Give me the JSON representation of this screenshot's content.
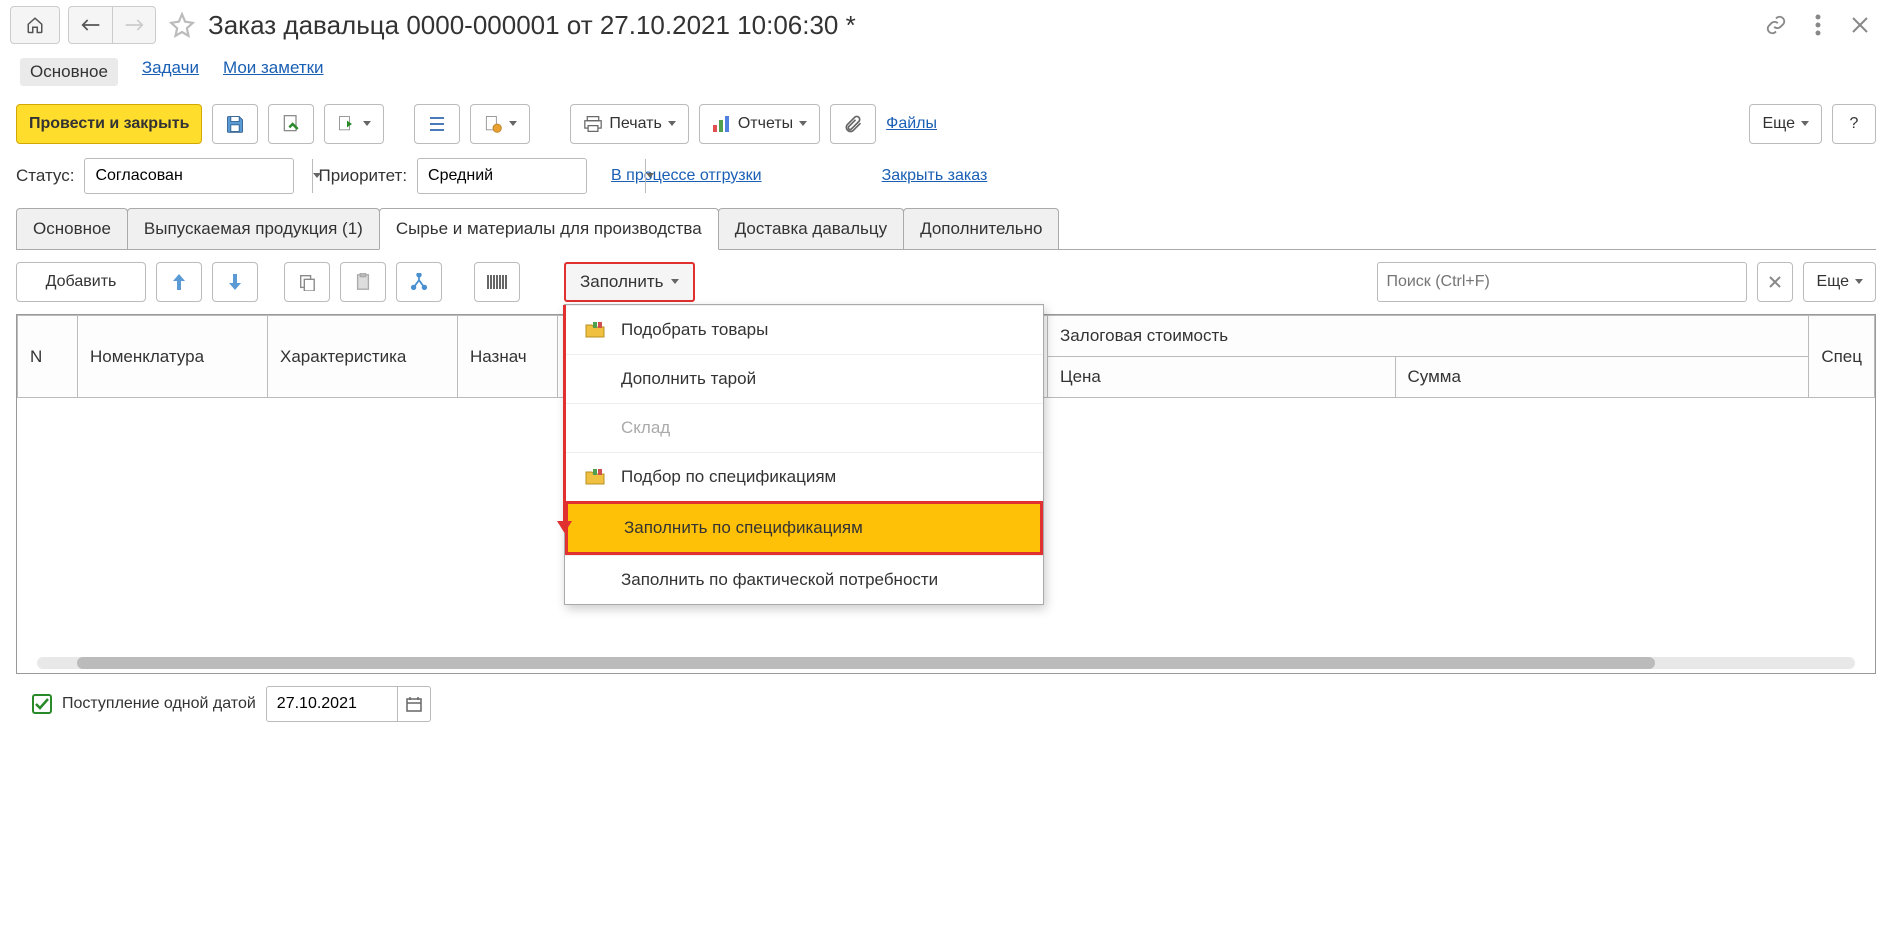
{
  "title": "Заказ давальца 0000-000001 от 27.10.2021 10:06:30 *",
  "nav": {
    "main": "Основное",
    "tasks": "Задачи",
    "notes": "Мои заметки"
  },
  "toolbar": {
    "post_close": "Провести и закрыть",
    "print": "Печать",
    "reports": "Отчеты",
    "files": "Файлы",
    "more": "Еще",
    "help": "?"
  },
  "status": {
    "label": "Статус:",
    "value": "Согласован",
    "priority_label": "Приоритет:",
    "priority_value": "Средний",
    "shipping": "В процессе отгрузки",
    "close_order": "Закрыть заказ"
  },
  "doc_tabs": {
    "main": "Основное",
    "products": "Выпускаемая продукция (1)",
    "materials": "Сырье и материалы для производства",
    "delivery": "Доставка давальцу",
    "additional": "Дополнительно"
  },
  "sub_toolbar": {
    "add": "Добавить",
    "fill": "Заполнить",
    "search_placeholder": "Поиск (Ctrl+F)",
    "more": "Еще"
  },
  "fill_menu": {
    "pick_goods": "Подобрать товары",
    "add_tare": "Дополнить тарой",
    "warehouse": "Склад",
    "pick_spec": "Подбор по спецификациям",
    "fill_spec": "Заполнить по спецификациям",
    "fill_actual": "Заполнить по фактической потребности"
  },
  "table": {
    "col_n": "N",
    "col_item": "Номенклатура",
    "col_char": "Характеристика",
    "col_purpose": "Назнач",
    "col_deposit": "Залоговая стоимость",
    "col_price": "Цена",
    "col_sum": "Сумма",
    "col_spec": "Спец"
  },
  "footer": {
    "single_date": "Поступление одной датой",
    "date": "27.10.2021"
  }
}
